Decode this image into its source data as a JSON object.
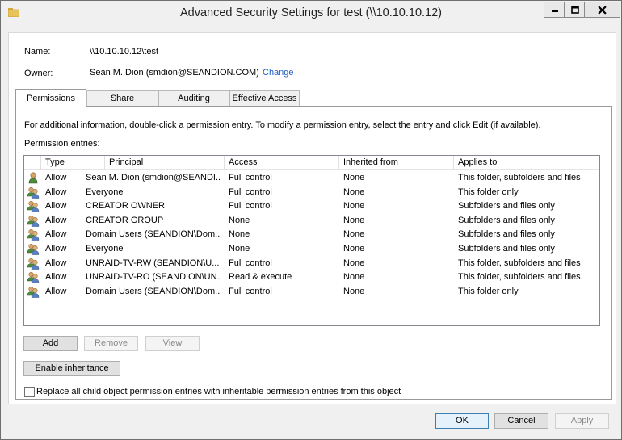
{
  "window": {
    "title": "Advanced Security Settings for test (\\\\10.10.10.12)",
    "min_glyph": "—",
    "close_glyph": "✕"
  },
  "info": {
    "name_label": "Name:",
    "name_value": "\\\\10.10.10.12\\test",
    "owner_label": "Owner:",
    "owner_value": "Sean M. Dion (smdion@SEANDION.COM)",
    "change_link": "Change"
  },
  "tabs": [
    "Permissions",
    "Share",
    "Auditing",
    "Effective Access"
  ],
  "panel": {
    "info_text": "For additional information, double-click a permission entry. To modify a permission entry, select the entry and click Edit (if available).",
    "entries_label": "Permission entries:"
  },
  "table": {
    "headers": [
      "Type",
      "Principal",
      "Access",
      "Inherited from",
      "Applies to"
    ],
    "rows": [
      {
        "type": "Allow",
        "principal": "Sean M. Dion (smdion@SEANDI...",
        "access": "Full control",
        "inherited": "None",
        "applies": "This folder, subfolders and files",
        "icon": "single-user-icon"
      },
      {
        "type": "Allow",
        "principal": "Everyone",
        "access": "Full control",
        "inherited": "None",
        "applies": "This folder only",
        "icon": "user-group-icon"
      },
      {
        "type": "Allow",
        "principal": "CREATOR OWNER",
        "access": "Full control",
        "inherited": "None",
        "applies": "Subfolders and files only",
        "icon": "user-group-icon"
      },
      {
        "type": "Allow",
        "principal": "CREATOR GROUP",
        "access": "None",
        "inherited": "None",
        "applies": "Subfolders and files only",
        "icon": "user-group-icon"
      },
      {
        "type": "Allow",
        "principal": "Domain Users (SEANDION\\Dom...",
        "access": "None",
        "inherited": "None",
        "applies": "Subfolders and files only",
        "icon": "user-group-icon"
      },
      {
        "type": "Allow",
        "principal": "Everyone",
        "access": "None",
        "inherited": "None",
        "applies": "Subfolders and files only",
        "icon": "user-group-icon"
      },
      {
        "type": "Allow",
        "principal": "UNRAID-TV-RW (SEANDION\\U...",
        "access": "Full control",
        "inherited": "None",
        "applies": "This folder, subfolders and files",
        "icon": "user-group-icon"
      },
      {
        "type": "Allow",
        "principal": "UNRAID-TV-RO (SEANDION\\UN...",
        "access": "Read & execute",
        "inherited": "None",
        "applies": "This folder, subfolders and files",
        "icon": "user-group-icon"
      },
      {
        "type": "Allow",
        "principal": "Domain Users (SEANDION\\Dom...",
        "access": "Full control",
        "inherited": "None",
        "applies": "This folder only",
        "icon": "user-group-icon"
      }
    ]
  },
  "buttons": {
    "add": "Add",
    "remove": "Remove",
    "view": "View",
    "enable_inheritance": "Enable inheritance",
    "ok": "OK",
    "cancel": "Cancel",
    "apply": "Apply"
  },
  "replace_checkbox_label": "Replace all child object permission entries with inheritable permission entries from this object",
  "colors": {
    "link": "#1f5fbf",
    "folder": "#e8c35a"
  }
}
